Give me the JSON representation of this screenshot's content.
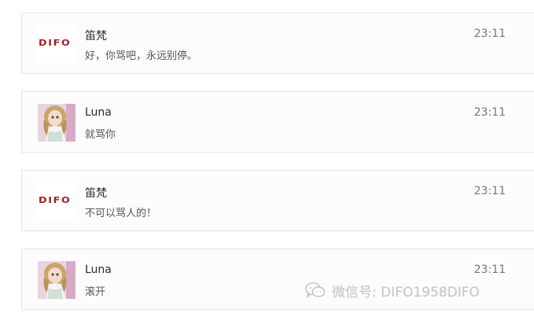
{
  "messages": [
    {
      "sender": "笛梵",
      "avatar": "difo-logo",
      "logo_text": "DIFO",
      "text": "好，你骂吧，永远别停。",
      "time": "23:11"
    },
    {
      "sender": "Luna",
      "avatar": "doll-photo",
      "text": "就骂你",
      "time": "23:11"
    },
    {
      "sender": "笛梵",
      "avatar": "difo-logo",
      "logo_text": "DIFO",
      "text": "不可以骂人的！",
      "time": "23:11"
    },
    {
      "sender": "Luna",
      "avatar": "doll-photo",
      "text": "滚开",
      "time": "23:11"
    }
  ],
  "watermark": {
    "icon": "wechat-icon",
    "text": "微信号: DIFO1958DIFO"
  },
  "colors": {
    "brand_red": "#a01c24",
    "card_border": "#e4e4e8",
    "card_bg": "#fcfcfd"
  }
}
